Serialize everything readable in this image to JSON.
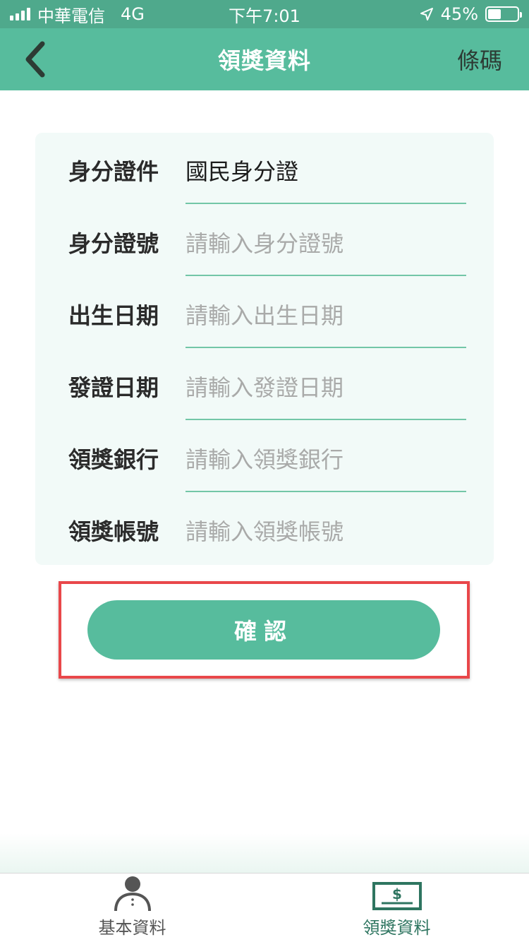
{
  "status_bar": {
    "carrier": "中華電信",
    "network": "4G",
    "time": "下午7:01",
    "battery": "45%",
    "battery_level": 0.45
  },
  "header": {
    "title": "領獎資料",
    "right_label": "條碼",
    "back_icon": "chevron-left-icon"
  },
  "form": {
    "fields": [
      {
        "label": "身分證件",
        "value": "國民身分證",
        "placeholder": ""
      },
      {
        "label": "身分證號",
        "value": "",
        "placeholder": "請輸入身分證號"
      },
      {
        "label": "出生日期",
        "value": "",
        "placeholder": "請輸入出生日期"
      },
      {
        "label": "發證日期",
        "value": "",
        "placeholder": "請輸入發證日期"
      },
      {
        "label": "領獎銀行",
        "value": "",
        "placeholder": "請輸入領獎銀行"
      },
      {
        "label": "領獎帳號",
        "value": "",
        "placeholder": "請輸入領獎帳號"
      }
    ]
  },
  "confirm_button": {
    "label": "確認"
  },
  "tabbar": {
    "tabs": [
      {
        "label": "基本資料",
        "icon": "person-icon",
        "active": false
      },
      {
        "label": "領獎資料",
        "icon": "money-bill-icon",
        "active": true
      }
    ]
  },
  "colors": {
    "primary": "#57bc9d",
    "status_bar": "#4fa98c",
    "highlight": "#e9474a",
    "card_bg": "#f2faf8"
  }
}
